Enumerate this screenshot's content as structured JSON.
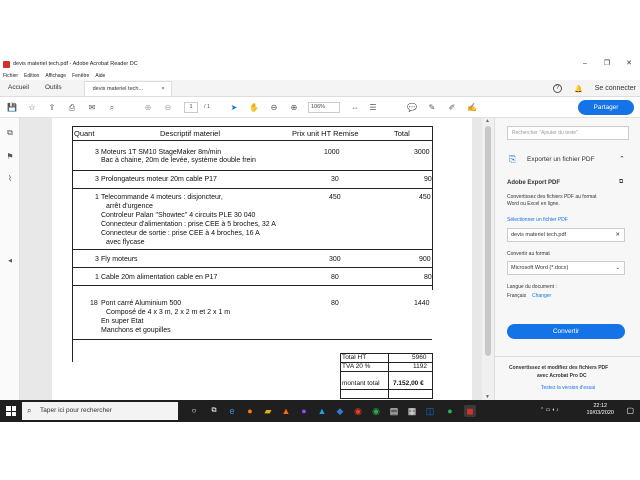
{
  "window": {
    "title": "devis materiel tech.pdf - Adobe Acrobat Reader DC",
    "controls": [
      "–",
      "❐",
      "✕"
    ]
  },
  "menu": [
    "Fichier",
    "Edition",
    "Affichage",
    "Fenêtre",
    "Aide"
  ],
  "tabs": {
    "home": "Accueil",
    "tools": "Outils",
    "doc": "devis materiel tech...",
    "doc_close": "×",
    "signin": "Se connecter"
  },
  "toolbar": {
    "page_current": "1",
    "page_total": "/ 1",
    "zoom": "106%",
    "share": "Partager"
  },
  "quote": {
    "headers": {
      "qty": "Quant",
      "desc": "Descriptif materiel",
      "unit_price": "Prix unit HT Remise",
      "total": "Total"
    },
    "rows": [
      {
        "qty": "3",
        "lines": [
          "Moteurs 1T SM10 StageMaker 8m/min",
          "Bac à chaine, 20m de levée, système double frein"
        ],
        "price": "1000",
        "total": "3000"
      },
      {
        "qty": "3",
        "lines": [
          "Prolongateurs moteur 20m cable P17"
        ],
        "price": "30",
        "total": "90"
      },
      {
        "qty": "1",
        "lines": [
          "Telecommande 4 moteurs : disjoncteur,",
          "arrêt d'urgence",
          "Controleur Palan \"Showtec\" 4 circuits PLE 30 040",
          "Connecteur d'alimentation : prise CEE à 5 broches, 32 A",
          "Connecteur de sortie : prise CEE à 4 broches, 16 A",
          "avec flycase"
        ],
        "price": "450",
        "total": "450"
      },
      {
        "qty": "3",
        "lines": [
          "Fly moteurs"
        ],
        "price": "300",
        "total": "900"
      },
      {
        "qty": "1",
        "lines": [
          "Cable 20m alimentation cable en P17"
        ],
        "price": "80",
        "total": "80"
      },
      {
        "qty": "18",
        "lines": [
          "Pont carré Aluminium 500",
          "Composé de 4 x 3 m, 2 x 2 m et 2 x 1 m",
          "En super Etat",
          "Manchons et goupilles"
        ],
        "price": "80",
        "total": "1440"
      }
    ],
    "summary": {
      "total_ht_label": "Total HT",
      "total_ht": "5960",
      "tva_label": "TVA 20 %",
      "tva": "1192",
      "montant_label": "montant total",
      "montant": "7.152,00 €"
    }
  },
  "sidepane": {
    "search_placeholder": "Rechercher \"Ajouter du texte\"",
    "export_title": "Exporter un fichier PDF",
    "adobe_export": "Adobe Export PDF",
    "desc1": "Convertissez des fichiers PDF au format",
    "desc2": "Word ou Excel en ligne.",
    "select_file": "Sélectionner un fichier PDF",
    "file_name": "devis materiel tech.pdf",
    "convert_to": "Convertir au format",
    "format": "Microsoft Word (*.docx)",
    "lang_label": "Langue du document :",
    "lang_value": "Français",
    "change": "Changer",
    "convert": "Convertir",
    "promo1": "Convertissez et modifiez des fichiers PDF",
    "promo2": "avec Acrobat Pro DC",
    "trial": "Testez la version d'essai"
  },
  "taskbar": {
    "search": "Taper ici pour rechercher",
    "time": "22:12",
    "date": "19/03/2020"
  },
  "colors": {
    "accent": "#1473e6",
    "pdf_red": "#d3302b",
    "taskbar": "#1f1f1f"
  }
}
